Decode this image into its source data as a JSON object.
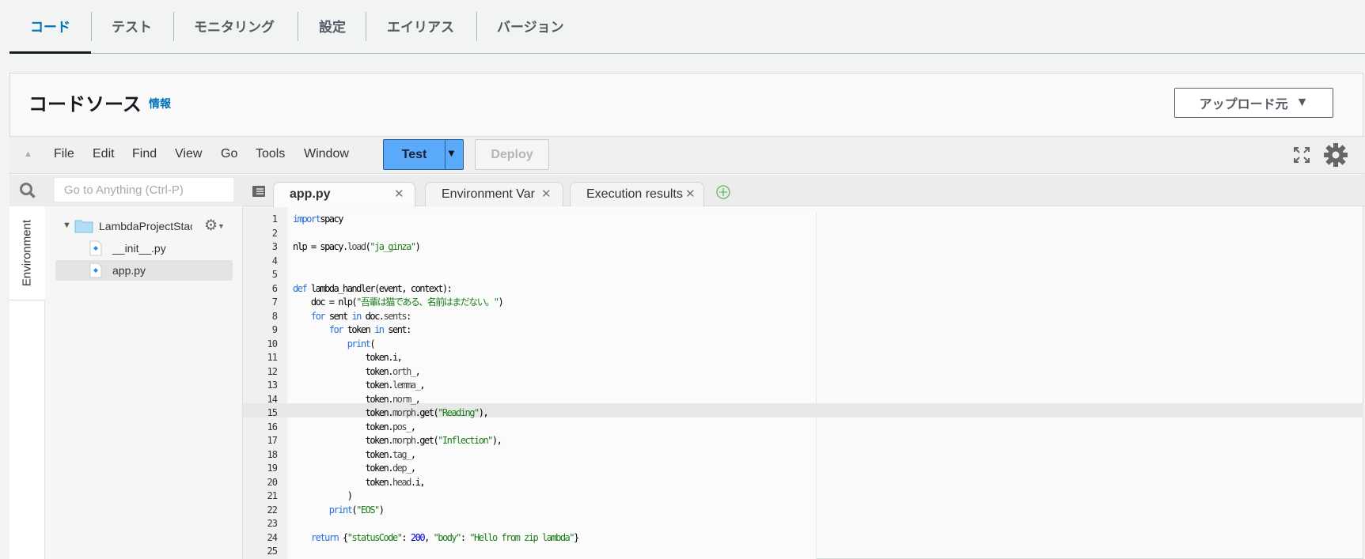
{
  "top_tabs": [
    "コード",
    "テスト",
    "モニタリング",
    "設定",
    "エイリアス",
    "バージョン"
  ],
  "section": {
    "title": "コードソース",
    "info_link": "情報",
    "upload_button": "アップロード元"
  },
  "toolbar": {
    "menus": [
      "File",
      "Edit",
      "Find",
      "View",
      "Go",
      "Tools",
      "Window"
    ],
    "test_label": "Test",
    "deploy_label": "Deploy"
  },
  "sidebar": {
    "goto_placeholder": "Go to Anything (Ctrl-P)",
    "env_tab": "Environment",
    "folder": "LambdaProjectStack",
    "files": [
      "__init__.py",
      "app.py"
    ]
  },
  "editor": {
    "tabs": [
      "app.py",
      "Environment Var",
      "Execution results"
    ],
    "highlighted_line": 15,
    "lines": [
      [
        [
          "kw",
          "import"
        ],
        [
          "",
          "spacy"
        ]
      ],
      [],
      [
        [
          "",
          "nlp = spacy."
        ],
        [
          "at",
          "load"
        ],
        [
          "",
          "("
        ],
        [
          "st",
          "\"ja_ginza\""
        ],
        [
          "",
          ")"
        ]
      ],
      [],
      [],
      [
        [
          "kw",
          "def"
        ],
        [
          "",
          " lambda_handler(event, context):"
        ]
      ],
      [
        [
          "",
          "    doc = nlp("
        ],
        [
          "st",
          "\"吾輩は猫である、名前はまだない。\""
        ],
        [
          "",
          ")"
        ]
      ],
      [
        [
          "",
          "    "
        ],
        [
          "kw",
          "for"
        ],
        [
          "",
          " sent "
        ],
        [
          "kw",
          "in"
        ],
        [
          "",
          " doc."
        ],
        [
          "at",
          "sents"
        ],
        [
          "",
          ":"
        ]
      ],
      [
        [
          "",
          "        "
        ],
        [
          "kw",
          "for"
        ],
        [
          "",
          " token "
        ],
        [
          "kw",
          "in"
        ],
        [
          "",
          " sent:"
        ]
      ],
      [
        [
          "",
          "            "
        ],
        [
          "kw",
          "print"
        ],
        [
          "",
          "("
        ]
      ],
      [
        [
          "",
          "                token.i,"
        ]
      ],
      [
        [
          "",
          "                token."
        ],
        [
          "at",
          "orth_"
        ],
        [
          "",
          ","
        ]
      ],
      [
        [
          "",
          "                token."
        ],
        [
          "at",
          "lemma_"
        ],
        [
          "",
          ","
        ]
      ],
      [
        [
          "",
          "                token."
        ],
        [
          "at",
          "norm_"
        ],
        [
          "",
          ","
        ]
      ],
      [
        [
          "",
          "                token."
        ],
        [
          "at",
          "morph"
        ],
        [
          "",
          ".get("
        ],
        [
          "st",
          "\"Reading\""
        ],
        [
          "",
          "),"
        ]
      ],
      [
        [
          "",
          "                token."
        ],
        [
          "at",
          "pos_"
        ],
        [
          "",
          ","
        ]
      ],
      [
        [
          "",
          "                token."
        ],
        [
          "at",
          "morph"
        ],
        [
          "",
          ".get("
        ],
        [
          "st",
          "\"Inflection\""
        ],
        [
          "",
          "),"
        ]
      ],
      [
        [
          "",
          "                token."
        ],
        [
          "at",
          "tag_"
        ],
        [
          "",
          ","
        ]
      ],
      [
        [
          "",
          "                token."
        ],
        [
          "at",
          "dep_"
        ],
        [
          "",
          ","
        ]
      ],
      [
        [
          "",
          "                token."
        ],
        [
          "at",
          "head"
        ],
        [
          "",
          ".i,"
        ]
      ],
      [
        [
          "",
          "            )"
        ]
      ],
      [
        [
          "",
          "        "
        ],
        [
          "kw",
          "print"
        ],
        [
          "",
          "("
        ],
        [
          "st",
          "\"EOS\""
        ],
        [
          "",
          ")"
        ]
      ],
      [],
      [
        [
          "",
          "    "
        ],
        [
          "kw",
          "return"
        ],
        [
          "",
          " {"
        ],
        [
          "st",
          "\"statusCode\""
        ],
        [
          "",
          ": "
        ],
        [
          "nm",
          "200"
        ],
        [
          "",
          ", "
        ],
        [
          "st",
          "\"body\""
        ],
        [
          "",
          ": "
        ],
        [
          "st",
          "\"Hello from zip lambda\""
        ],
        [
          "",
          "}"
        ]
      ],
      []
    ]
  }
}
